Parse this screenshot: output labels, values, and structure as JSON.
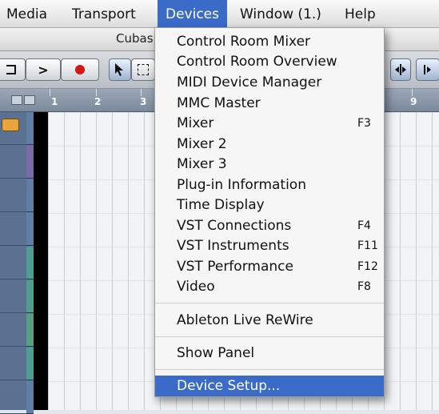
{
  "menubar": {
    "items": [
      "Media",
      "Transport",
      "Devices",
      "Window (1.)",
      "Help"
    ]
  },
  "titlebar": {
    "title": "Cubas"
  },
  "toolbar": {
    "play_symbol": ">"
  },
  "ruler": {
    "labels": [
      "1",
      "2",
      "3",
      "9"
    ]
  },
  "menu": {
    "items": [
      {
        "label": "Control Room Mixer",
        "shortcut": ""
      },
      {
        "label": "Control Room Overview",
        "shortcut": ""
      },
      {
        "label": "MIDI Device Manager",
        "shortcut": ""
      },
      {
        "label": "MMC Master",
        "shortcut": ""
      },
      {
        "label": "Mixer",
        "shortcut": "F3"
      },
      {
        "label": "Mixer 2",
        "shortcut": ""
      },
      {
        "label": "Mixer 3",
        "shortcut": ""
      },
      {
        "label": "Plug-in Information",
        "shortcut": ""
      },
      {
        "label": "Time Display",
        "shortcut": ""
      },
      {
        "label": "VST Connections",
        "shortcut": "F4"
      },
      {
        "label": "VST Instruments",
        "shortcut": "F11"
      },
      {
        "label": "VST Performance",
        "shortcut": "F12"
      },
      {
        "label": "Video",
        "shortcut": "F8"
      },
      {
        "label": "Ableton Live ReWire",
        "shortcut": ""
      },
      {
        "label": "Show Panel",
        "shortcut": ""
      },
      {
        "label": "Device Setup...",
        "shortcut": ""
      }
    ],
    "highlighted": "Device Setup..."
  },
  "colors": {
    "selection": "#3a6bc9",
    "record": "#d01818",
    "track_strip": [
      "#5f7ea6",
      "#7a6aa8",
      "#5f7ea6",
      "#5f7ea6",
      "#4f9e94",
      "#4f9e8a",
      "#5a9e82",
      "#4f9e94",
      "#5f7ea6"
    ]
  }
}
